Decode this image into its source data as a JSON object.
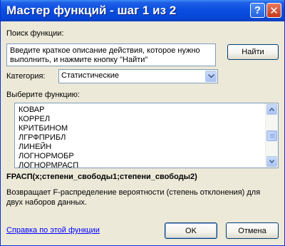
{
  "window": {
    "title": "Мастер функций - шаг 1 из 2",
    "help_button": "?",
    "close_button": "✕"
  },
  "search": {
    "label": "Поиск функции:",
    "text": "Введите краткое описание действия, которое нужно выполнить, и нажмите кнопку \"Найти\"",
    "find_button": "Найти"
  },
  "category": {
    "label": "Категория:",
    "selected": "Статистические"
  },
  "functions": {
    "label": "Выберите функцию:",
    "items": [
      "КОВАР",
      "КОРРЕЛ",
      "КРИТБИНОМ",
      "ЛГРФПРИБЛ",
      "ЛИНЕЙН",
      "ЛОГНОРМОБР",
      "ЛОГНОРМРАСП"
    ]
  },
  "selected_function": {
    "signature": "FРАСП(x;степени_свободы1;степени_свободы2)",
    "description": "Возвращает F-распределение вероятности (степень отклонения) для двух наборов данных."
  },
  "footer": {
    "help_link": "Справка по этой функции",
    "ok_button": "OK",
    "cancel_button": "Отмена"
  },
  "icons": {
    "combo_arrow": "chevron-down-icon",
    "scroll_up": "scroll-up-icon",
    "scroll_down": "scroll-down-icon"
  }
}
